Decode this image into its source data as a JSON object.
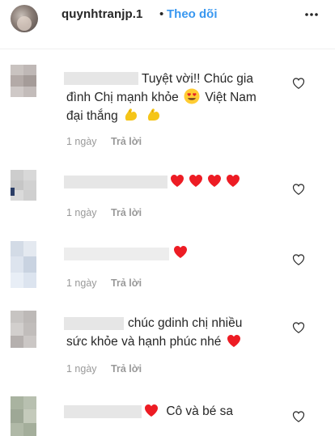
{
  "header": {
    "username": "quynhtranjp.1",
    "separator": "•",
    "follow_label": "Theo dõi"
  },
  "comments": [
    {
      "lines": [
        "Tuyệt vời!! Chúc gia",
        "đình Chị mạnh khỏe",
        "Việt Nam",
        "đại thắng"
      ],
      "time": "1 ngày",
      "reply": "Trả lời"
    },
    {
      "time": "1 ngày",
      "reply": "Trả lời"
    },
    {
      "time": "1 ngày",
      "reply": "Trả lời"
    },
    {
      "lines": [
        "chúc gdinh chị nhiều",
        "sức khỏe và hạnh phúc nhé"
      ],
      "time": "1 ngày",
      "reply": "Trả lời"
    },
    {
      "lines": [
        "Cô và bé sa"
      ]
    }
  ],
  "colors": {
    "follow": "#3897f0",
    "heart": "#ed1c24",
    "meta": "#999999"
  },
  "icons": {
    "more": "more-dots-icon",
    "like": "heart-outline-icon"
  }
}
